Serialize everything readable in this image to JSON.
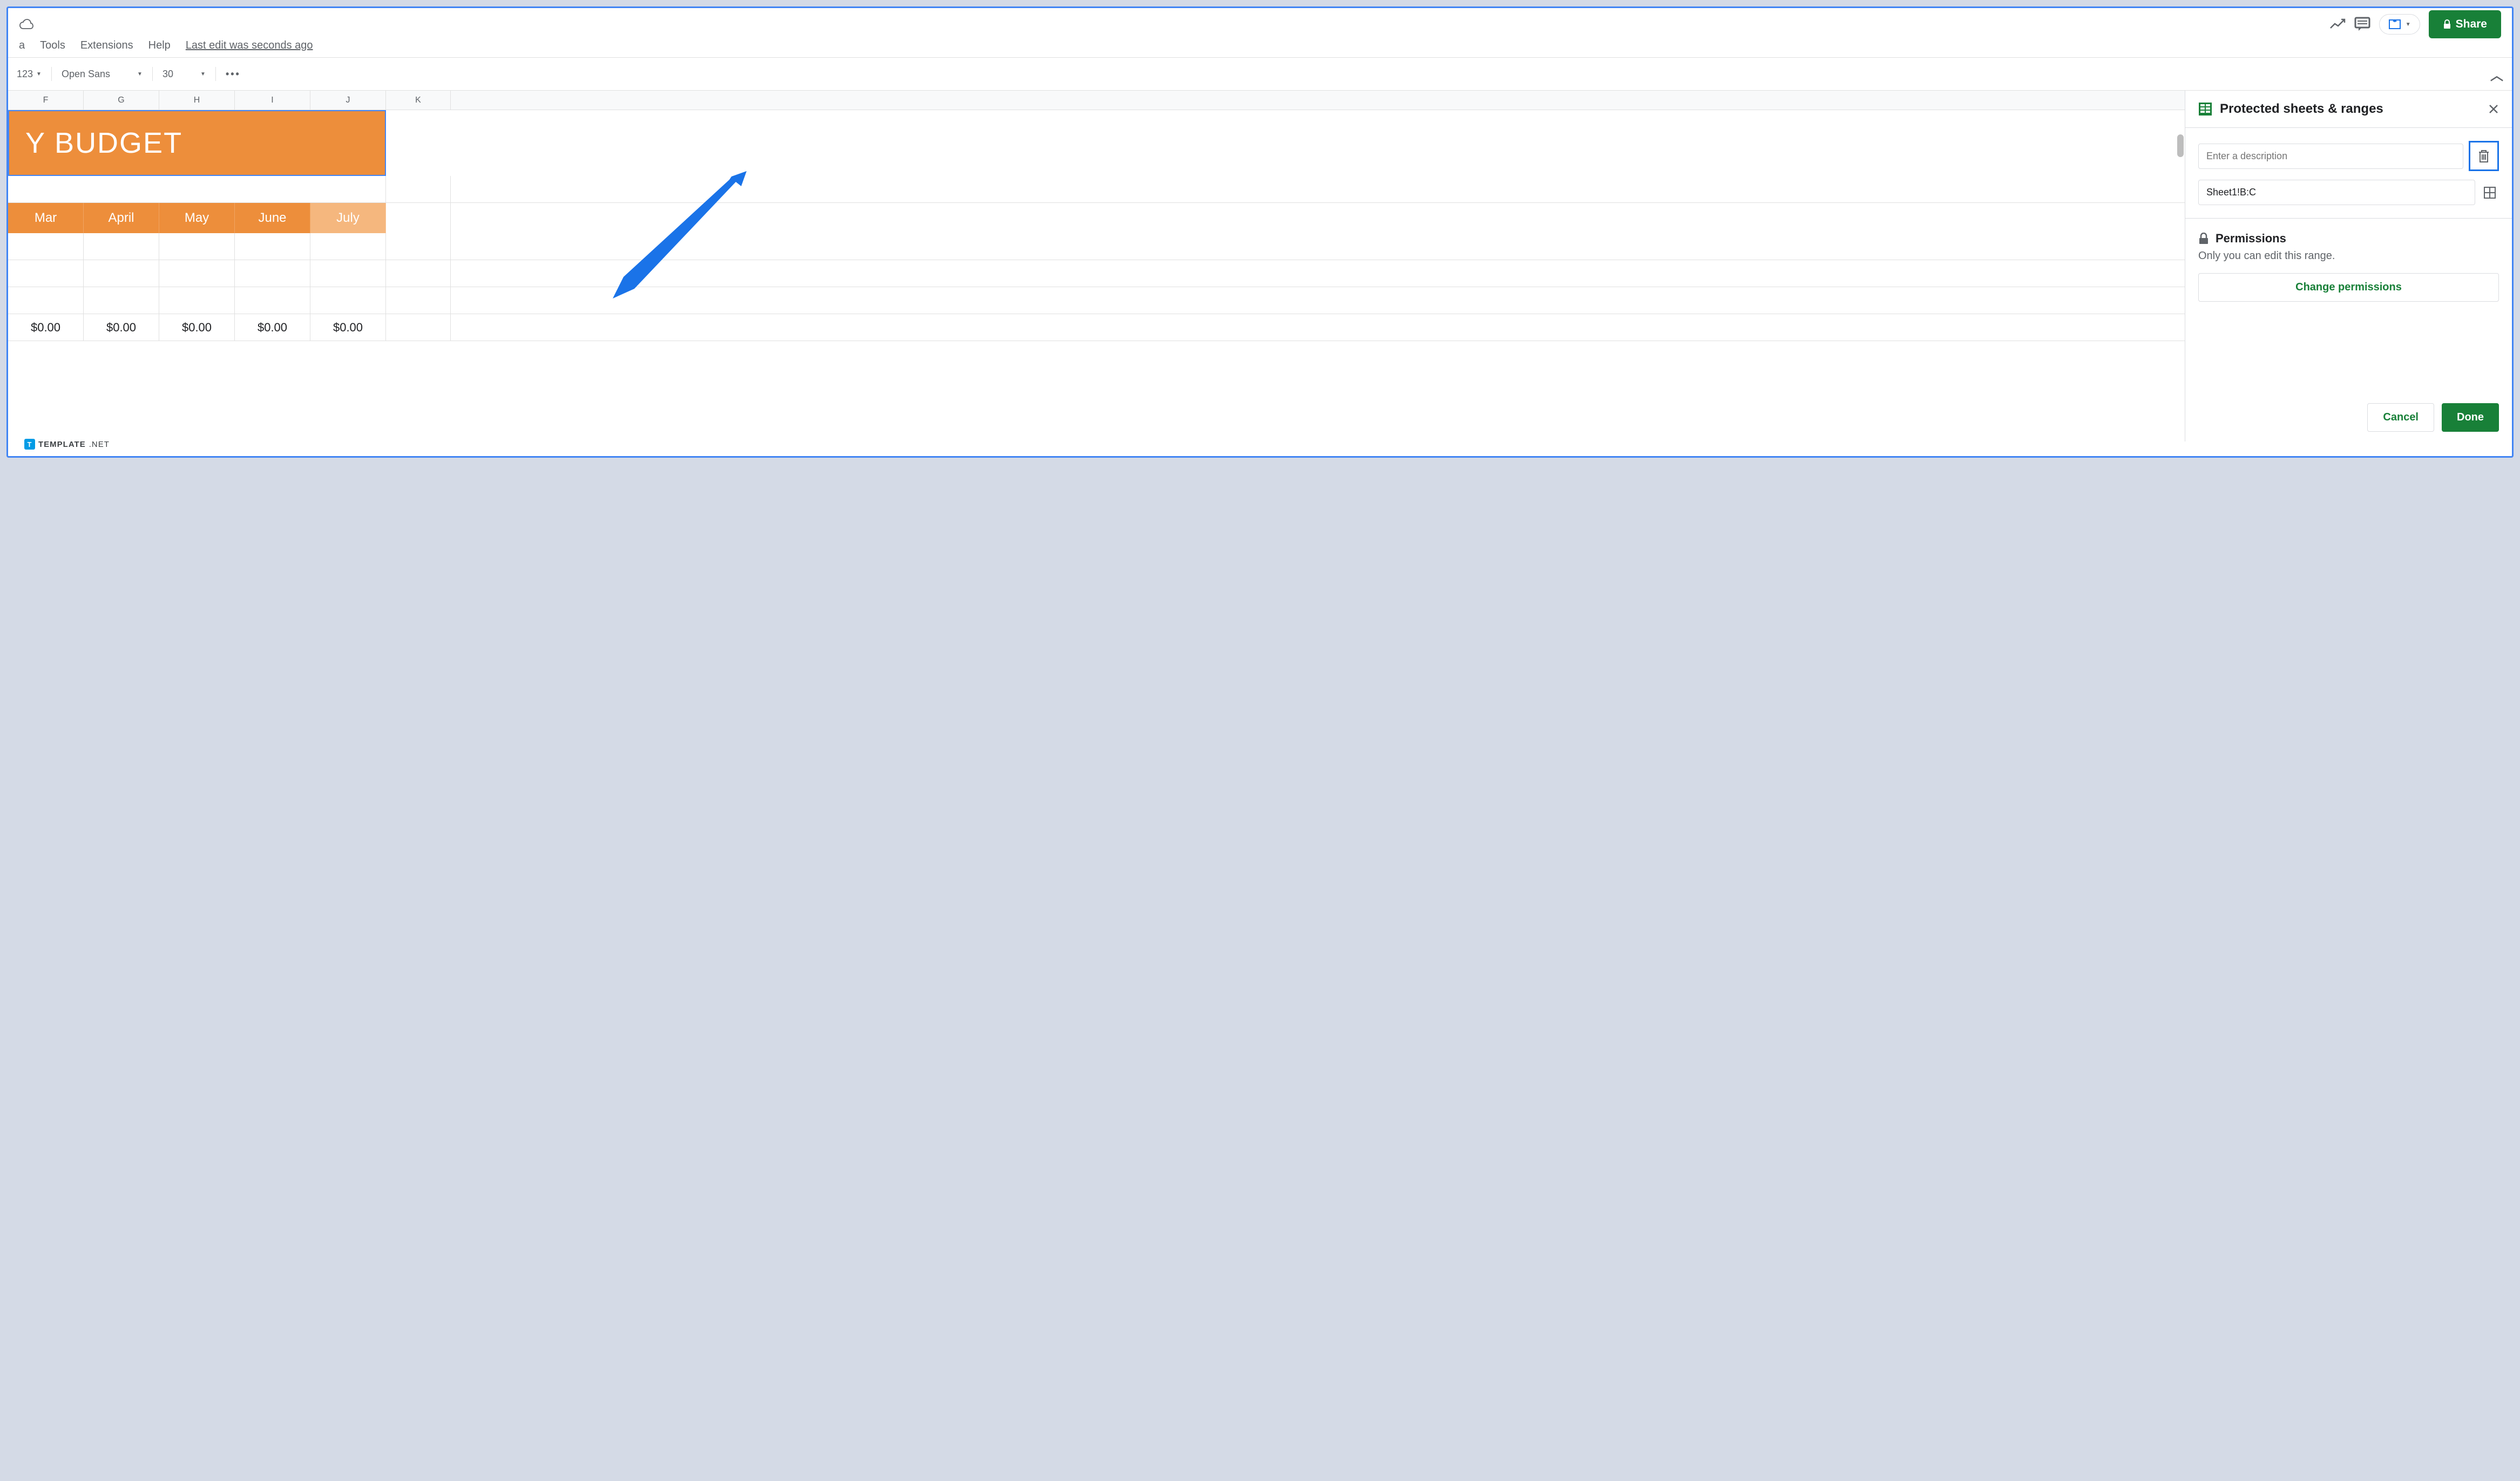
{
  "menubar": {
    "a": "a",
    "tools": "Tools",
    "extensions": "Extensions",
    "help": "Help",
    "last_edit": "Last edit was seconds ago"
  },
  "toolbar": {
    "num123": "123",
    "font": "Open Sans",
    "fontsize": "30"
  },
  "share": {
    "label": "Share"
  },
  "columns": {
    "f": "F",
    "g": "G",
    "h": "H",
    "i": "I",
    "j": "J",
    "k": "K"
  },
  "banner": {
    "text": "Y BUDGET"
  },
  "months": {
    "mar": "Mar",
    "april": "April",
    "may": "May",
    "june": "June",
    "july": "July"
  },
  "values": {
    "v1": "$0.00",
    "v2": "$0.00",
    "v3": "$0.00",
    "v4": "$0.00",
    "v5": "$0.00"
  },
  "sidepanel": {
    "title": "Protected sheets & ranges",
    "desc_placeholder": "Enter a description",
    "range": "Sheet1!B:C",
    "perms_label": "Permissions",
    "perms_desc": "Only you can edit this range.",
    "change_perms": "Change permissions",
    "cancel": "Cancel",
    "done": "Done"
  },
  "watermark": {
    "text": "TEMPLATE",
    "suffix": ".NET"
  }
}
